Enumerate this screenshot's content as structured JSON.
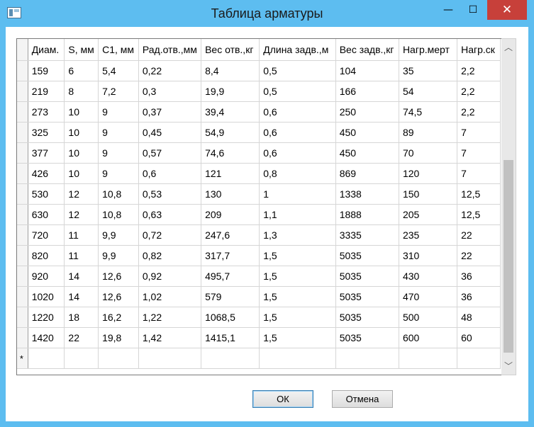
{
  "window": {
    "title": "Таблица арматуры",
    "minimize_glyph": "—",
    "maximize_glyph": "☐",
    "close_glyph": "✕"
  },
  "grid": {
    "columns": [
      "Диам.",
      "S, мм",
      "C1, мм",
      "Рад.отв.,мм",
      "Вес отв.,кг",
      "Длина задв.,м",
      "Вес задв.,кг",
      "Нагр.мерт",
      "Нагр.ск"
    ],
    "rows": [
      [
        "159",
        "6",
        "5,4",
        "0,22",
        "8,4",
        "0,5",
        "104",
        "35",
        "2,2"
      ],
      [
        "219",
        "8",
        "7,2",
        "0,3",
        "19,9",
        "0,5",
        "166",
        "54",
        "2,2"
      ],
      [
        "273",
        "10",
        "9",
        "0,37",
        "39,4",
        "0,6",
        "250",
        "74,5",
        "2,2"
      ],
      [
        "325",
        "10",
        "9",
        "0,45",
        "54,9",
        "0,6",
        "450",
        "89",
        "7"
      ],
      [
        "377",
        "10",
        "9",
        "0,57",
        "74,6",
        "0,6",
        "450",
        "70",
        "7"
      ],
      [
        "426",
        "10",
        "9",
        "0,6",
        "121",
        "0,8",
        "869",
        "120",
        "7"
      ],
      [
        "530",
        "12",
        "10,8",
        "0,53",
        "130",
        "1",
        "1338",
        "150",
        "12,5"
      ],
      [
        "630",
        "12",
        "10,8",
        "0,63",
        "209",
        "1,1",
        "1888",
        "205",
        "12,5"
      ],
      [
        "720",
        "11",
        "9,9",
        "0,72",
        "247,6",
        "1,3",
        "3335",
        "235",
        "22"
      ],
      [
        "820",
        "11",
        "9,9",
        "0,82",
        "317,7",
        "1,5",
        "5035",
        "310",
        "22"
      ],
      [
        "920",
        "14",
        "12,6",
        "0,92",
        "495,7",
        "1,5",
        "5035",
        "430",
        "36"
      ],
      [
        "1020",
        "14",
        "12,6",
        "1,02",
        "579",
        "1,5",
        "5035",
        "470",
        "36"
      ],
      [
        "1220",
        "18",
        "16,2",
        "1,22",
        "1068,5",
        "1,5",
        "5035",
        "500",
        "48"
      ],
      [
        "1420",
        "22",
        "19,8",
        "1,42",
        "1415,1",
        "1,5",
        "5035",
        "600",
        "60"
      ]
    ],
    "new_row_marker": "*"
  },
  "scrollbar": {
    "up_glyph": "︿",
    "down_glyph": "﹀"
  },
  "buttons": {
    "ok_label": "ОК",
    "cancel_label": "Отмена"
  }
}
